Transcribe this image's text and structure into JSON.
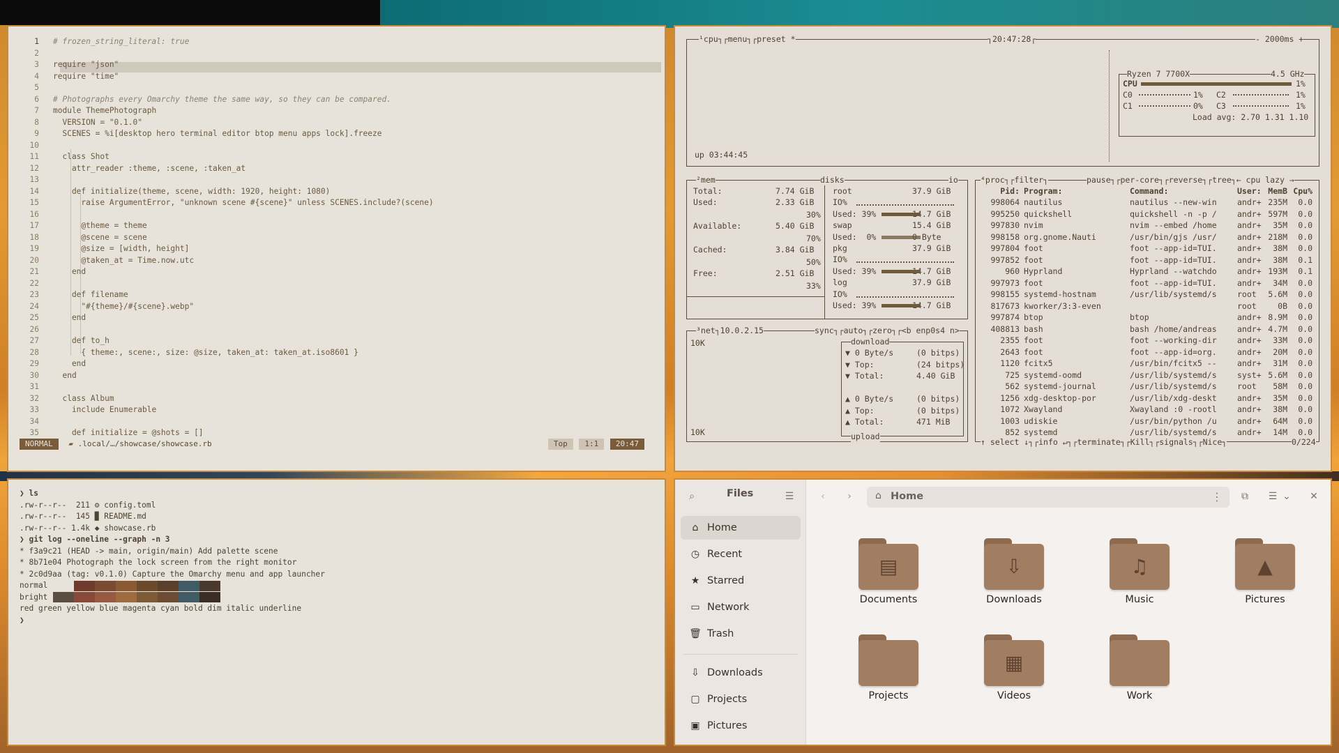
{
  "editor": {
    "lines": [
      {
        "n": "1",
        "html": "cm",
        "text": "# frozen_string_literal: true"
      },
      {
        "n": "2",
        "text": ""
      },
      {
        "n": "3",
        "text": "require \"json\""
      },
      {
        "n": "4",
        "text": "require \"time\""
      },
      {
        "n": "5",
        "text": ""
      },
      {
        "n": "6",
        "html": "cm",
        "text": "# Photographs every Omarchy theme the same way, so they can be compared."
      },
      {
        "n": "7",
        "text": "module ThemePhotograph"
      },
      {
        "n": "8",
        "text": "  VERSION = \"0.1.0\""
      },
      {
        "n": "9",
        "text": "  SCENES = %i[desktop hero terminal editor btop menu apps lock].freeze"
      },
      {
        "n": "10",
        "text": ""
      },
      {
        "n": "11",
        "text": "  class Shot"
      },
      {
        "n": "12",
        "text": "    attr_reader :theme, :scene, :taken_at"
      },
      {
        "n": "13",
        "text": ""
      },
      {
        "n": "14",
        "text": "    def initialize(theme, scene, width: 1920, height: 1080)"
      },
      {
        "n": "15",
        "text": "      raise ArgumentError, \"unknown scene #{scene}\" unless SCENES.include?(scene)"
      },
      {
        "n": "16",
        "text": ""
      },
      {
        "n": "17",
        "text": "      @theme = theme"
      },
      {
        "n": "18",
        "text": "      @scene = scene"
      },
      {
        "n": "19",
        "text": "      @size = [width, height]"
      },
      {
        "n": "20",
        "text": "      @taken_at = Time.now.utc"
      },
      {
        "n": "21",
        "text": "    end"
      },
      {
        "n": "22",
        "text": ""
      },
      {
        "n": "23",
        "text": "    def filename"
      },
      {
        "n": "24",
        "text": "      \"#{theme}/#{scene}.webp\""
      },
      {
        "n": "25",
        "text": "    end"
      },
      {
        "n": "26",
        "text": ""
      },
      {
        "n": "27",
        "text": "    def to_h"
      },
      {
        "n": "28",
        "text": "      { theme:, scene:, size: @size, taken_at: taken_at.iso8601 }"
      },
      {
        "n": "29",
        "text": "    end"
      },
      {
        "n": "30",
        "text": "  end"
      },
      {
        "n": "31",
        "text": ""
      },
      {
        "n": "32",
        "text": "  class Album"
      },
      {
        "n": "33",
        "text": "    include Enumerable"
      },
      {
        "n": "34",
        "text": ""
      },
      {
        "n": "35",
        "text": "    def initialize = @shots = []"
      }
    ],
    "status": {
      "mode": "NORMAL",
      "file": ".local/…/showcase/showcase.rb",
      "pos": "Top",
      "linecol": "1:1",
      "clock": "20:47"
    }
  },
  "btop": {
    "top": {
      "cpu": "¹cpu",
      "menu": "menu",
      "preset": "preset *",
      "time": "20:47:28",
      "interval": "- 2000ms +",
      "uptime": "up 03:44:45"
    },
    "cpu": {
      "model": "Ryzen 7 7700X",
      "freq": "4.5 GHz",
      "total_label": "CPU",
      "total": "1%",
      "cores": [
        {
          "n": "C0",
          "v": "1%"
        },
        {
          "n": "C2",
          "v": "1%"
        },
        {
          "n": "C1",
          "v": "0%"
        },
        {
          "n": "C3",
          "v": "1%"
        }
      ],
      "load": "Load avg: 2.70 1.31 1.10"
    },
    "mem": {
      "title": "²mem",
      "total_l": "Total:",
      "total": "7.74 GiB",
      "used_l": "Used:",
      "used": "2.33 GiB",
      "used_p": "30%",
      "avail_l": "Available:",
      "avail": "5.40 GiB",
      "avail_p": "70%",
      "cached_l": "Cached:",
      "cached": "3.84 GiB",
      "cached_p": "50%",
      "free_l": "Free:",
      "free": "2.51 GiB",
      "free_p": "33%"
    },
    "disks": {
      "title": "disks",
      "io": "io",
      "rows": [
        {
          "a": "root",
          "b": "37.9 GiB"
        },
        {
          "a": "IO%",
          "b": ""
        },
        {
          "a": "Used: 39%",
          "b": "14.7 GiB"
        },
        {
          "a": "swap",
          "b": "15.4 GiB"
        },
        {
          "a": "Used:  0%",
          "b": "0 Byte"
        },
        {
          "a": "pkg",
          "b": "37.9 GiB"
        },
        {
          "a": "IO%",
          "b": ""
        },
        {
          "a": "Used: 39%",
          "b": "14.7 GiB"
        },
        {
          "a": "log",
          "b": "37.9 GiB"
        },
        {
          "a": "IO%",
          "b": ""
        },
        {
          "a": "Used: 39%",
          "b": "14.7 GiB"
        }
      ]
    },
    "net": {
      "title": "³net",
      "ip": "10.0.2.15",
      "sync": "sync",
      "auto": "auto",
      "zero": "zero",
      "iface": "<b enp0s4 n>",
      "scale_top": "10K",
      "scale_bot": "10K",
      "download": "download",
      "upload": "upload",
      "dl": [
        {
          "a": "▼ 0 Byte/s",
          "b": "(0 bitps)"
        },
        {
          "a": "▼ Top:",
          "b": "(24 bitps)"
        },
        {
          "a": "▼ Total:",
          "b": "4.40 GiB"
        }
      ],
      "ul": [
        {
          "a": "▲ 0 Byte/s",
          "b": "(0 bitps)"
        },
        {
          "a": "▲ Top:",
          "b": "(0 bitps)"
        },
        {
          "a": "▲ Total:",
          "b": "471 MiB"
        }
      ]
    },
    "proc": {
      "title": "⁴proc",
      "filter": "filter",
      "pause": "pause",
      "percore": "per-core",
      "reverse": "reverse",
      "tree": "tree",
      "sort": "← cpu lazy →",
      "headers": [
        "Pid:",
        "Program:",
        "Command:",
        "User:",
        "MemB",
        "Cpu%"
      ],
      "rows": [
        [
          "998064",
          "nautilus",
          "nautilus --new-win",
          "andr+",
          "235M",
          "0.0"
        ],
        [
          "995250",
          "quickshell",
          "quickshell -n -p /",
          "andr+",
          "597M",
          "0.0"
        ],
        [
          "997830",
          "nvim",
          "nvim --embed /home",
          "andr+",
          "35M",
          "0.0"
        ],
        [
          "998158",
          "org.gnome.Nauti",
          "/usr/bin/gjs /usr/",
          "andr+",
          "218M",
          "0.0"
        ],
        [
          "997804",
          "foot",
          "foot --app-id=TUI.",
          "andr+",
          "38M",
          "0.0"
        ],
        [
          "997852",
          "foot",
          "foot --app-id=TUI.",
          "andr+",
          "38M",
          "0.1"
        ],
        [
          "960",
          "Hyprland",
          "Hyprland --watchdo",
          "andr+",
          "193M",
          "0.1"
        ],
        [
          "997973",
          "foot",
          "foot --app-id=TUI.",
          "andr+",
          "34M",
          "0.0"
        ],
        [
          "998155",
          "systemd-hostnam",
          "/usr/lib/systemd/s",
          "root",
          "5.6M",
          "0.0"
        ],
        [
          "817673",
          "kworker/3:3-even",
          "",
          "root",
          "0B",
          "0.0"
        ],
        [
          "997874",
          "btop",
          "btop",
          "andr+",
          "8.9M",
          "0.0"
        ],
        [
          "408813",
          "bash",
          "bash /home/andreas",
          "andr+",
          "4.7M",
          "0.0"
        ],
        [
          "2355",
          "foot",
          "foot --working-dir",
          "andr+",
          "33M",
          "0.0"
        ],
        [
          "2643",
          "foot",
          "foot --app-id=org.",
          "andr+",
          "20M",
          "0.0"
        ],
        [
          "1120",
          "fcitx5",
          "/usr/bin/fcitx5 --",
          "andr+",
          "31M",
          "0.0"
        ],
        [
          "725",
          "systemd-oomd",
          "/usr/lib/systemd/s",
          "syst+",
          "5.6M",
          "0.0"
        ],
        [
          "562",
          "systemd-journal",
          "/usr/lib/systemd/s",
          "root",
          "58M",
          "0.0"
        ],
        [
          "1256",
          "xdg-desktop-por",
          "/usr/lib/xdg-deskt",
          "andr+",
          "35M",
          "0.0"
        ],
        [
          "1072",
          "Xwayland",
          "Xwayland :0 -rootl",
          "andr+",
          "38M",
          "0.0"
        ],
        [
          "1003",
          "udiskie",
          "/usr/bin/python /u",
          "andr+",
          "64M",
          "0.0"
        ],
        [
          "852",
          "systemd",
          "/usr/lib/systemd/s",
          "andr+",
          "14M",
          "0.0"
        ]
      ],
      "footer": {
        "select": "↑ select ↓",
        "info": "info ↵",
        "terminate": "terminate",
        "kill": "Kill",
        "signals": "signals",
        "nice": "Nice",
        "count": "0/224"
      }
    }
  },
  "terminal": {
    "lines": [
      {
        "t": "❯ ls",
        "b": true
      },
      {
        "t": ".rw-r--r--  211 ⚙ config.toml"
      },
      {
        "t": ".rw-r--r--  145 ▉ README.md"
      },
      {
        "t": ".rw-r--r-- 1.4k ◆ showcase.rb"
      },
      {
        "t": "❯ git log --oneline --graph -n 3",
        "b": true
      },
      {
        "t": "* f3a9c21 (HEAD -> main, origin/main) Add palette scene"
      },
      {
        "t": "* 8b71e04 Photograph the lock screen from the right monitor"
      },
      {
        "t": "* 2c0d9aa (tag: v0.1.0) Capture the Omarchy menu and app launcher"
      },
      {
        "t": "normal"
      },
      {
        "t": "bright"
      },
      {
        "t": "red green yellow blue magenta cyan bold dim italic underline"
      },
      {
        "t": "❯"
      }
    ],
    "normal_colors": [
      "#e7e2da",
      "#6e3a2c",
      "#7a4a33",
      "#8a5a35",
      "#6a4a2a",
      "#5a3f2b",
      "#3f5b63",
      "#4a3a2e"
    ],
    "bright_colors": [
      "#5a4e42",
      "#86493a",
      "#955a3f",
      "#a06a3f",
      "#7d5a36",
      "#6d4c36",
      "#3f5b63",
      "#3a2d24"
    ]
  },
  "files": {
    "title": "Files",
    "path": "Home",
    "places": [
      {
        "icon": "⌂",
        "label": "Home",
        "active": true
      },
      {
        "icon": "◷",
        "label": "Recent"
      },
      {
        "icon": "★",
        "label": "Starred"
      },
      {
        "icon": "▭",
        "label": "Network"
      },
      {
        "icon": "🗑",
        "label": "Trash"
      }
    ],
    "bookmarks": [
      {
        "icon": "⇩",
        "label": "Downloads"
      },
      {
        "icon": "▢",
        "label": "Projects"
      },
      {
        "icon": "▣",
        "label": "Pictures"
      }
    ],
    "folders": [
      {
        "label": "Documents",
        "sym": "▤"
      },
      {
        "label": "Downloads",
        "sym": "⇩"
      },
      {
        "label": "Music",
        "sym": "♫"
      },
      {
        "label": "Pictures",
        "sym": "▲"
      },
      {
        "label": "Projects",
        "sym": ""
      },
      {
        "label": "Videos",
        "sym": "▦"
      },
      {
        "label": "Work",
        "sym": ""
      }
    ]
  }
}
